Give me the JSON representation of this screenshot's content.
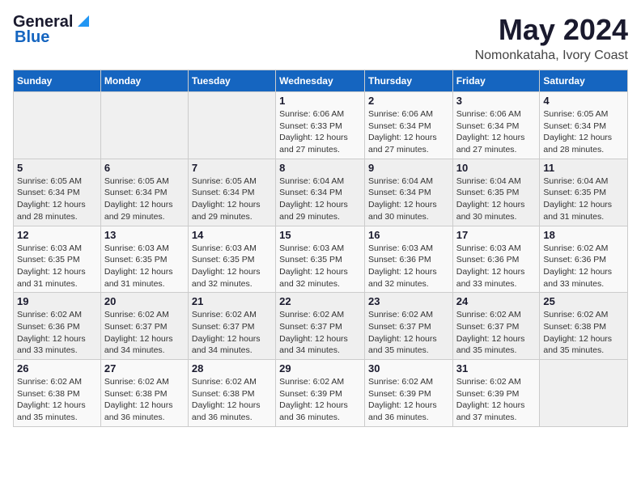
{
  "header": {
    "logo_general": "General",
    "logo_blue": "Blue",
    "month_year": "May 2024",
    "location": "Nomonkataha, Ivory Coast"
  },
  "calendar": {
    "weekdays": [
      "Sunday",
      "Monday",
      "Tuesday",
      "Wednesday",
      "Thursday",
      "Friday",
      "Saturday"
    ],
    "weeks": [
      [
        {
          "day": "",
          "sunrise": "",
          "sunset": "",
          "daylight": ""
        },
        {
          "day": "",
          "sunrise": "",
          "sunset": "",
          "daylight": ""
        },
        {
          "day": "",
          "sunrise": "",
          "sunset": "",
          "daylight": ""
        },
        {
          "day": "1",
          "sunrise": "Sunrise: 6:06 AM",
          "sunset": "Sunset: 6:33 PM",
          "daylight": "Daylight: 12 hours and 27 minutes."
        },
        {
          "day": "2",
          "sunrise": "Sunrise: 6:06 AM",
          "sunset": "Sunset: 6:34 PM",
          "daylight": "Daylight: 12 hours and 27 minutes."
        },
        {
          "day": "3",
          "sunrise": "Sunrise: 6:06 AM",
          "sunset": "Sunset: 6:34 PM",
          "daylight": "Daylight: 12 hours and 27 minutes."
        },
        {
          "day": "4",
          "sunrise": "Sunrise: 6:05 AM",
          "sunset": "Sunset: 6:34 PM",
          "daylight": "Daylight: 12 hours and 28 minutes."
        }
      ],
      [
        {
          "day": "5",
          "sunrise": "Sunrise: 6:05 AM",
          "sunset": "Sunset: 6:34 PM",
          "daylight": "Daylight: 12 hours and 28 minutes."
        },
        {
          "day": "6",
          "sunrise": "Sunrise: 6:05 AM",
          "sunset": "Sunset: 6:34 PM",
          "daylight": "Daylight: 12 hours and 29 minutes."
        },
        {
          "day": "7",
          "sunrise": "Sunrise: 6:05 AM",
          "sunset": "Sunset: 6:34 PM",
          "daylight": "Daylight: 12 hours and 29 minutes."
        },
        {
          "day": "8",
          "sunrise": "Sunrise: 6:04 AM",
          "sunset": "Sunset: 6:34 PM",
          "daylight": "Daylight: 12 hours and 29 minutes."
        },
        {
          "day": "9",
          "sunrise": "Sunrise: 6:04 AM",
          "sunset": "Sunset: 6:34 PM",
          "daylight": "Daylight: 12 hours and 30 minutes."
        },
        {
          "day": "10",
          "sunrise": "Sunrise: 6:04 AM",
          "sunset": "Sunset: 6:35 PM",
          "daylight": "Daylight: 12 hours and 30 minutes."
        },
        {
          "day": "11",
          "sunrise": "Sunrise: 6:04 AM",
          "sunset": "Sunset: 6:35 PM",
          "daylight": "Daylight: 12 hours and 31 minutes."
        }
      ],
      [
        {
          "day": "12",
          "sunrise": "Sunrise: 6:03 AM",
          "sunset": "Sunset: 6:35 PM",
          "daylight": "Daylight: 12 hours and 31 minutes."
        },
        {
          "day": "13",
          "sunrise": "Sunrise: 6:03 AM",
          "sunset": "Sunset: 6:35 PM",
          "daylight": "Daylight: 12 hours and 31 minutes."
        },
        {
          "day": "14",
          "sunrise": "Sunrise: 6:03 AM",
          "sunset": "Sunset: 6:35 PM",
          "daylight": "Daylight: 12 hours and 32 minutes."
        },
        {
          "day": "15",
          "sunrise": "Sunrise: 6:03 AM",
          "sunset": "Sunset: 6:35 PM",
          "daylight": "Daylight: 12 hours and 32 minutes."
        },
        {
          "day": "16",
          "sunrise": "Sunrise: 6:03 AM",
          "sunset": "Sunset: 6:36 PM",
          "daylight": "Daylight: 12 hours and 32 minutes."
        },
        {
          "day": "17",
          "sunrise": "Sunrise: 6:03 AM",
          "sunset": "Sunset: 6:36 PM",
          "daylight": "Daylight: 12 hours and 33 minutes."
        },
        {
          "day": "18",
          "sunrise": "Sunrise: 6:02 AM",
          "sunset": "Sunset: 6:36 PM",
          "daylight": "Daylight: 12 hours and 33 minutes."
        }
      ],
      [
        {
          "day": "19",
          "sunrise": "Sunrise: 6:02 AM",
          "sunset": "Sunset: 6:36 PM",
          "daylight": "Daylight: 12 hours and 33 minutes."
        },
        {
          "day": "20",
          "sunrise": "Sunrise: 6:02 AM",
          "sunset": "Sunset: 6:37 PM",
          "daylight": "Daylight: 12 hours and 34 minutes."
        },
        {
          "day": "21",
          "sunrise": "Sunrise: 6:02 AM",
          "sunset": "Sunset: 6:37 PM",
          "daylight": "Daylight: 12 hours and 34 minutes."
        },
        {
          "day": "22",
          "sunrise": "Sunrise: 6:02 AM",
          "sunset": "Sunset: 6:37 PM",
          "daylight": "Daylight: 12 hours and 34 minutes."
        },
        {
          "day": "23",
          "sunrise": "Sunrise: 6:02 AM",
          "sunset": "Sunset: 6:37 PM",
          "daylight": "Daylight: 12 hours and 35 minutes."
        },
        {
          "day": "24",
          "sunrise": "Sunrise: 6:02 AM",
          "sunset": "Sunset: 6:37 PM",
          "daylight": "Daylight: 12 hours and 35 minutes."
        },
        {
          "day": "25",
          "sunrise": "Sunrise: 6:02 AM",
          "sunset": "Sunset: 6:38 PM",
          "daylight": "Daylight: 12 hours and 35 minutes."
        }
      ],
      [
        {
          "day": "26",
          "sunrise": "Sunrise: 6:02 AM",
          "sunset": "Sunset: 6:38 PM",
          "daylight": "Daylight: 12 hours and 35 minutes."
        },
        {
          "day": "27",
          "sunrise": "Sunrise: 6:02 AM",
          "sunset": "Sunset: 6:38 PM",
          "daylight": "Daylight: 12 hours and 36 minutes."
        },
        {
          "day": "28",
          "sunrise": "Sunrise: 6:02 AM",
          "sunset": "Sunset: 6:38 PM",
          "daylight": "Daylight: 12 hours and 36 minutes."
        },
        {
          "day": "29",
          "sunrise": "Sunrise: 6:02 AM",
          "sunset": "Sunset: 6:39 PM",
          "daylight": "Daylight: 12 hours and 36 minutes."
        },
        {
          "day": "30",
          "sunrise": "Sunrise: 6:02 AM",
          "sunset": "Sunset: 6:39 PM",
          "daylight": "Daylight: 12 hours and 36 minutes."
        },
        {
          "day": "31",
          "sunrise": "Sunrise: 6:02 AM",
          "sunset": "Sunset: 6:39 PM",
          "daylight": "Daylight: 12 hours and 37 minutes."
        },
        {
          "day": "",
          "sunrise": "",
          "sunset": "",
          "daylight": ""
        }
      ]
    ]
  }
}
